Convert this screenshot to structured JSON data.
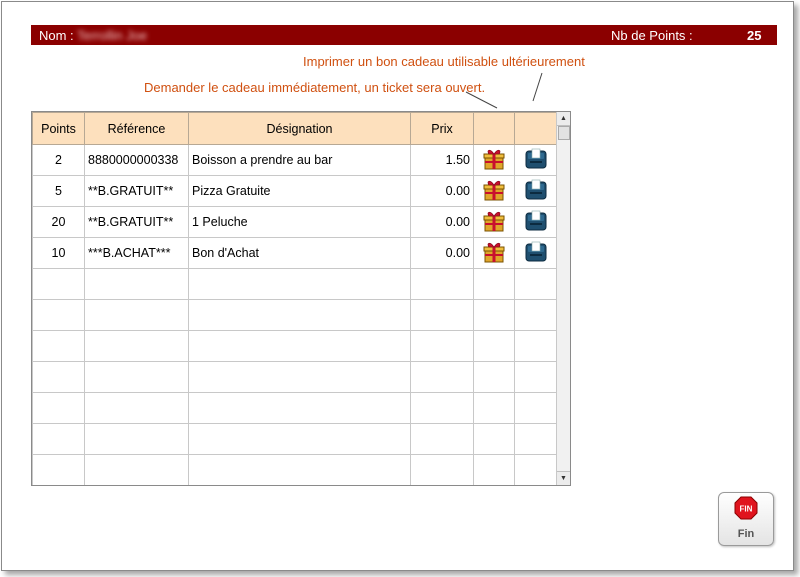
{
  "header": {
    "nom_label": "Nom :",
    "nom_value": "Terrollin Joe",
    "points_label": "Nb de Points :",
    "points_value": "25"
  },
  "hints": {
    "print": "Imprimer un bon cadeau utilisable ultérieurement",
    "request": "Demander le cadeau immédiatement, un ticket sera ouvert."
  },
  "table": {
    "columns": {
      "points": "Points",
      "reference": "Référence",
      "designation": "Désignation",
      "prix": "Prix",
      "request": "",
      "print": ""
    },
    "rows": [
      {
        "points": "2",
        "reference": "8880000000338",
        "designation": "Boisson a prendre au bar",
        "prix": "1.50"
      },
      {
        "points": "5",
        "reference": "**B.GRATUIT**",
        "designation": "Pizza Gratuite",
        "prix": "0.00"
      },
      {
        "points": "20",
        "reference": "**B.GRATUIT**",
        "designation": "1 Peluche",
        "prix": "0.00"
      },
      {
        "points": "10",
        "reference": "***B.ACHAT***",
        "designation": "Bon d'Achat",
        "prix": "0.00"
      }
    ],
    "icons": {
      "request": "gift-icon",
      "print": "printer-icon"
    }
  },
  "colors": {
    "header_bg": "#8b0000",
    "hint_text": "#d05010",
    "column_header_bg": "#fde0bd",
    "fin_red": "#e0141e"
  },
  "fin_button": {
    "label": "Fin",
    "icon_text": "FIN"
  }
}
